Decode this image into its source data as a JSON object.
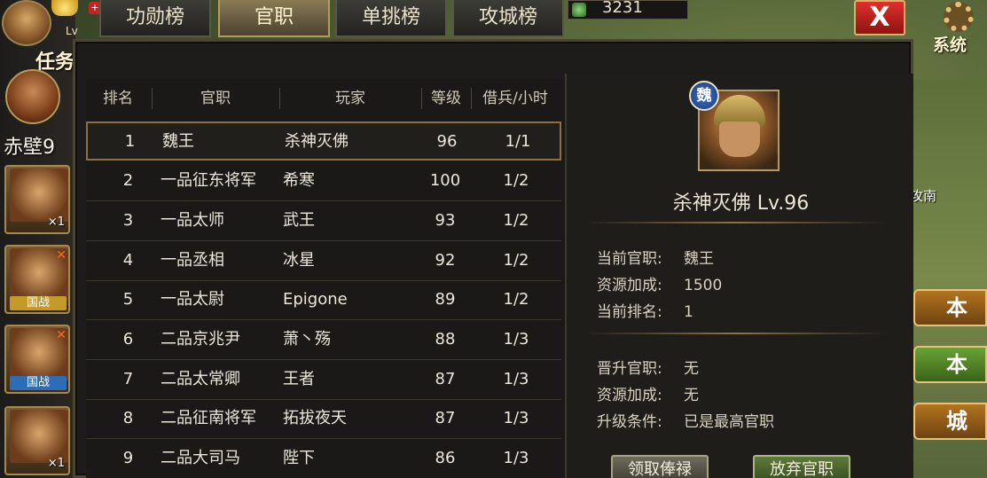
{
  "top": {
    "level_prefix": "Lv",
    "task_label": "任务",
    "resource_value": "3231",
    "close_label": "X",
    "system_label": "系统"
  },
  "tabs": [
    {
      "label": "功勋榜"
    },
    {
      "label": "官职"
    },
    {
      "label": "单挑榜"
    },
    {
      "label": "攻城榜"
    }
  ],
  "sidebar": {
    "zone": "赤壁9",
    "cards": [
      {
        "tag": "",
        "count": "×1"
      },
      {
        "tag": "国战",
        "count": ""
      },
      {
        "tag": "国战",
        "count": ""
      },
      {
        "tag": "",
        "count": "×1"
      }
    ]
  },
  "table": {
    "headers": [
      "排名",
      "官职",
      "玩家",
      "等级",
      "借兵/小时"
    ],
    "rows": [
      {
        "rank": "1",
        "title": "魏王",
        "player": "杀神灭佛",
        "level": "96",
        "troops": "1/1"
      },
      {
        "rank": "2",
        "title": "一品征东将军",
        "player": "希寒",
        "level": "100",
        "troops": "1/2"
      },
      {
        "rank": "3",
        "title": "一品太师",
        "player": "武王",
        "level": "93",
        "troops": "1/2"
      },
      {
        "rank": "4",
        "title": "一品丞相",
        "player": "冰星",
        "level": "92",
        "troops": "1/2"
      },
      {
        "rank": "5",
        "title": "一品太尉",
        "player": "Epigone",
        "level": "89",
        "troops": "1/2"
      },
      {
        "rank": "6",
        "title": "二品京兆尹",
        "player": "萧丶殇",
        "level": "88",
        "troops": "1/3"
      },
      {
        "rank": "7",
        "title": "二品太常卿",
        "player": "王者",
        "level": "87",
        "troops": "1/3"
      },
      {
        "rank": "8",
        "title": "二品征南将军",
        "player": "拓拔夜天",
        "level": "87",
        "troops": "1/3"
      },
      {
        "rank": "9",
        "title": "二品大司马",
        "player": "陛下",
        "level": "86",
        "troops": "1/3"
      }
    ]
  },
  "detail": {
    "kingdom": "魏",
    "name": "杀神灭佛  Lv.96",
    "current": [
      {
        "label": "当前官职:",
        "value": "魏王"
      },
      {
        "label": "资源加成:",
        "value": "1500"
      },
      {
        "label": "当前排名:",
        "value": "1"
      }
    ],
    "next": [
      {
        "label": "晋升官职:",
        "value": "无"
      },
      {
        "label": "资源加成:",
        "value": "无"
      },
      {
        "label": "升级条件:",
        "value": "已是最高官职"
      }
    ],
    "collect_button": "领取俸禄",
    "abandon_button": "放弃官职"
  },
  "map_buttons": [
    "本",
    "本",
    "城"
  ],
  "map_side_text": "攻南"
}
